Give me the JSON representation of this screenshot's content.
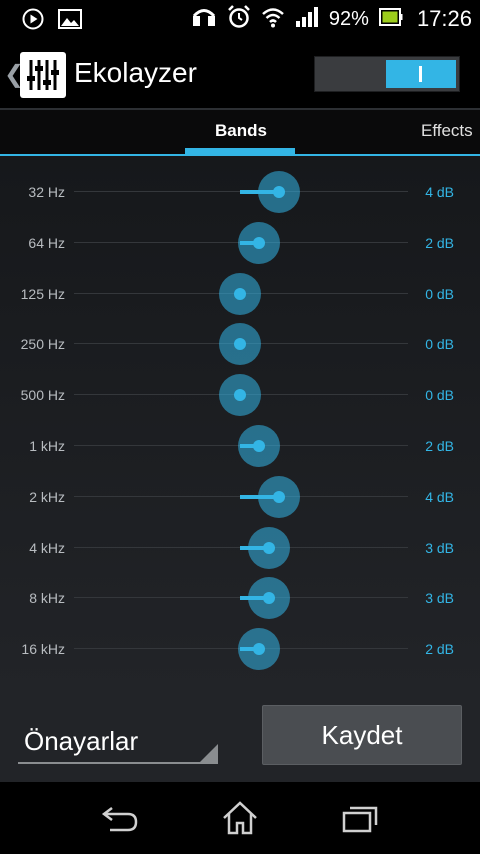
{
  "status_bar": {
    "battery_percent": "92%",
    "time": "17:26",
    "icons": [
      "play-icon",
      "image-icon",
      "headset-icon",
      "alarm-icon",
      "wifi-icon",
      "signal-icon",
      "battery-icon"
    ]
  },
  "action_bar": {
    "title": "Ekolayzer",
    "enabled": true
  },
  "tabs": [
    {
      "label": "Bands",
      "selected": true
    },
    {
      "label": "Effects",
      "selected": false
    }
  ],
  "bands": [
    {
      "freq": "32 Hz",
      "value": "4 dB",
      "db": 4
    },
    {
      "freq": "64 Hz",
      "value": "2 dB",
      "db": 2
    },
    {
      "freq": "125 Hz",
      "value": "0 dB",
      "db": 0
    },
    {
      "freq": "250 Hz",
      "value": "0 dB",
      "db": 0
    },
    {
      "freq": "500 Hz",
      "value": "0 dB",
      "db": 0
    },
    {
      "freq": "1 kHz",
      "value": "2 dB",
      "db": 2
    },
    {
      "freq": "2 kHz",
      "value": "4 dB",
      "db": 4
    },
    {
      "freq": "4 kHz",
      "value": "3 dB",
      "db": 3
    },
    {
      "freq": "8 kHz",
      "value": "3 dB",
      "db": 3
    },
    {
      "freq": "16 kHz",
      "value": "2 dB",
      "db": 2
    }
  ],
  "controls": {
    "preset_label": "Önayarlar",
    "save_label": "Kaydet"
  },
  "colors": {
    "accent": "#33b5e5",
    "background": "#1c1e21"
  }
}
